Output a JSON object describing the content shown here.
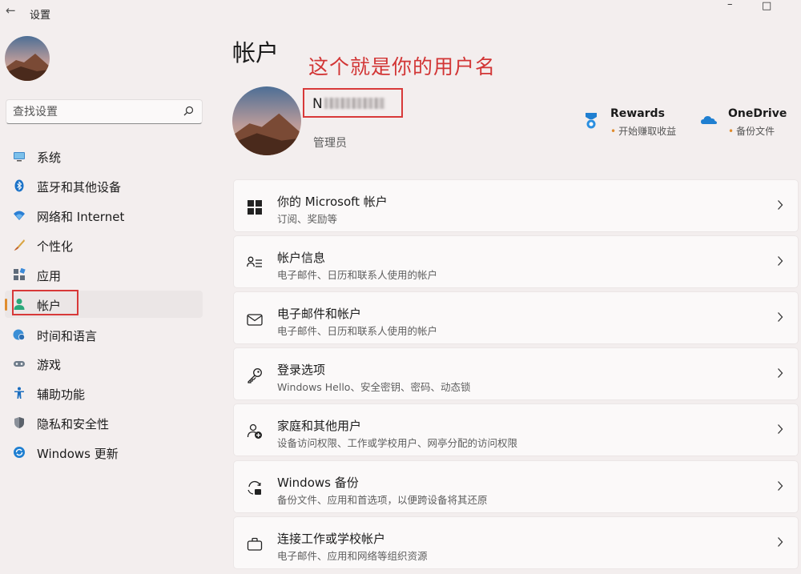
{
  "window": {
    "back_glyph": "←",
    "title": "设置",
    "minimize_glyph": "–",
    "maximize_glyph": "□",
    "close_glyph": ""
  },
  "sidebar": {
    "search": {
      "placeholder": "查找设置"
    },
    "items": [
      {
        "label": "系统",
        "icon": "monitor-icon",
        "active": false
      },
      {
        "label": "蓝牙和其他设备",
        "icon": "bluetooth-icon",
        "active": false
      },
      {
        "label": "网络和 Internet",
        "icon": "wifi-icon",
        "active": false
      },
      {
        "label": "个性化",
        "icon": "brush-icon",
        "active": false
      },
      {
        "label": "应用",
        "icon": "apps-icon",
        "active": false
      },
      {
        "label": "帐户",
        "icon": "person-icon",
        "active": true
      },
      {
        "label": "时间和语言",
        "icon": "globe-clock-icon",
        "active": false
      },
      {
        "label": "游戏",
        "icon": "gamepad-icon",
        "active": false
      },
      {
        "label": "辅助功能",
        "icon": "accessibility-icon",
        "active": false
      },
      {
        "label": "隐私和安全性",
        "icon": "shield-icon",
        "active": false
      },
      {
        "label": "Windows 更新",
        "icon": "update-icon",
        "active": false
      }
    ]
  },
  "header": {
    "page_title": "帐户",
    "annotation": "这个就是你的用户名",
    "username_visible": "N",
    "role": "管理员",
    "badges": [
      {
        "title": "Rewards",
        "subtitle": "开始赚取收益",
        "icon": "rewards-icon"
      },
      {
        "title": "OneDrive",
        "subtitle": "备份文件",
        "icon": "cloud-icon"
      }
    ]
  },
  "cards": [
    {
      "title": "你的 Microsoft 帐户",
      "subtitle": "订阅、奖励等",
      "icon": "windows-logo-icon"
    },
    {
      "title": "帐户信息",
      "subtitle": "电子邮件、日历和联系人使用的帐户",
      "icon": "account-info-icon"
    },
    {
      "title": "电子邮件和帐户",
      "subtitle": "电子邮件、日历和联系人使用的帐户",
      "icon": "mail-icon"
    },
    {
      "title": "登录选项",
      "subtitle": "Windows Hello、安全密钥、密码、动态锁",
      "icon": "key-icon"
    },
    {
      "title": "家庭和其他用户",
      "subtitle": "设备访问权限、工作或学校用户、网亭分配的访问权限",
      "icon": "family-icon"
    },
    {
      "title": "Windows 备份",
      "subtitle": "备份文件、应用和首选项，以便跨设备将其还原",
      "icon": "backup-icon"
    },
    {
      "title": "连接工作或学校帐户",
      "subtitle": "电子邮件、应用和网络等组织资源",
      "icon": "briefcase-icon"
    }
  ],
  "colors": {
    "accent": "#0067c0",
    "active_indicator": "#e08c2e",
    "annotation_red": "#d23535"
  }
}
